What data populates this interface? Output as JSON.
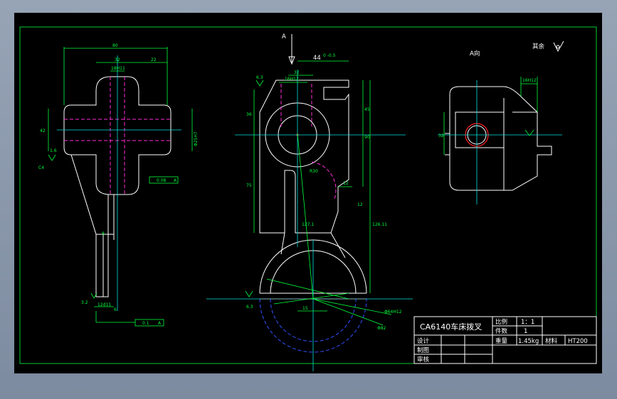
{
  "view_labels": {
    "arrow": "A",
    "view_a": "A向",
    "roughness_rest": "其余"
  },
  "dimensions": {
    "top_width": "80",
    "left_32": "32",
    "left_22": "22",
    "hole_fit": "18H11",
    "height_42": "42",
    "side_1_6": "1.6",
    "tol_box": "0.08",
    "datum_a": "A",
    "dim_8": "8",
    "rough_3_2": "3.2",
    "dim_12d11": "12d11",
    "dim_6": "6",
    "tol_box2": "0.1",
    "phi_h7": "Φ25H7",
    "top_44": "44",
    "top_44_tol": "0\n-0.5",
    "top_32": "32",
    "top_slot": "16H12",
    "d36": "36",
    "d45": "45",
    "d90": "90",
    "d75": "75",
    "d12": "12",
    "d12b": "12",
    "d126": "126.11",
    "r_label": "R30",
    "angle_127": "127.1",
    "d15": "15",
    "phi_r12": "Φ64H12",
    "phi_r82": "Φ82",
    "rough_6_3": "6.3",
    "rough_6_3b": "6.3",
    "dim_8b": "8",
    "dim_16h12": "16H12",
    "dim_32_right": "32"
  },
  "title_block": {
    "part_name": "CA6140车床拨叉",
    "scale_label": "比例",
    "scale_value": "1：1",
    "count_label": "件数",
    "count_value": "1",
    "weight_label": "重量",
    "weight_value": "1.45kg",
    "material_label": "材料",
    "material_value": "HT200",
    "row_design": "设计",
    "row_drawing": "制图",
    "row_review": "审核"
  }
}
